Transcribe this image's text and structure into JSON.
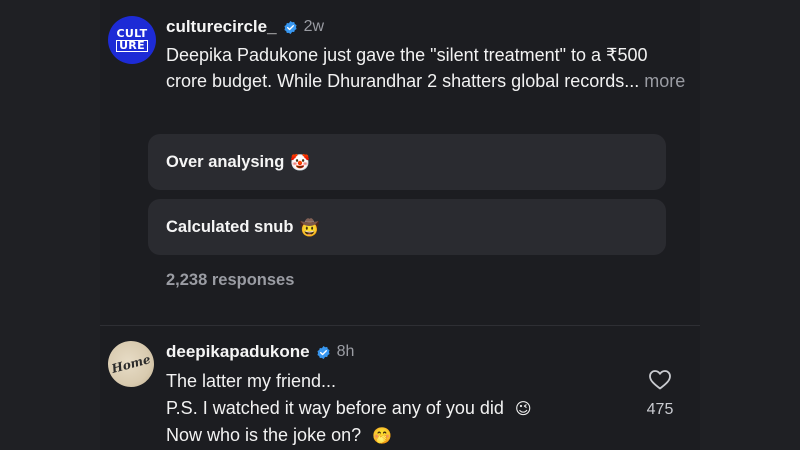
{
  "post": {
    "avatar_text_top": "CULT",
    "avatar_text_bottom": "URE",
    "username": "culturecircle_",
    "time": "2w",
    "caption": "Deepika Padukone just gave the \"silent treatment\" to a ₹500 crore budget. While Dhurandhar 2 shatters global records...",
    "more": "more",
    "options": [
      {
        "label": "Over analysing",
        "emoji": "🤡"
      },
      {
        "label": "Calculated snub",
        "emoji": "🤠"
      }
    ],
    "responses": "2,238 responses"
  },
  "comment": {
    "avatar_text": "Home",
    "username": "deepikapadukone",
    "time": "8h",
    "lines": [
      {
        "text": "The latter my friend...",
        "emoji": ""
      },
      {
        "text": "P.S. I watched it way before any of you did",
        "emoji": "😉"
      },
      {
        "text": "Now who is the joke on?",
        "emoji": "🤭"
      }
    ],
    "likes": "475"
  },
  "colors": {
    "background": "#1f2024",
    "verified": "#3897f0",
    "option_bg": "#2a2b30",
    "muted_text": "#9a9ca3"
  },
  "icons": [
    "verified-badge-icon",
    "heart-icon"
  ]
}
